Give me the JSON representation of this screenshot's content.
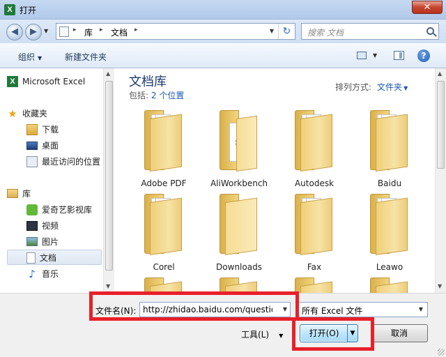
{
  "window": {
    "title": "打开",
    "app_icon": "X",
    "close_glyph": "✕"
  },
  "address_bar": {
    "crumbs": [
      "库",
      "文档"
    ],
    "separators": [
      "▸",
      "▸",
      "▸"
    ],
    "search_placeholder": "搜索 文档"
  },
  "toolbar": {
    "organize": "组织",
    "new_folder": "新建文件夹",
    "help": "?"
  },
  "sidebar": {
    "items": [
      {
        "label": "Microsoft Excel"
      },
      {
        "label": "收藏夹"
      },
      {
        "label": "下载"
      },
      {
        "label": "桌面"
      },
      {
        "label": "最近访问的位置"
      },
      {
        "label": "库"
      },
      {
        "label": "爱奇艺影视库"
      },
      {
        "label": "视频"
      },
      {
        "label": "图片"
      },
      {
        "label": "文档",
        "selected": true
      },
      {
        "label": "音乐"
      }
    ]
  },
  "library": {
    "title": "文档库",
    "includes_label": "包括:",
    "includes_link": "2 个位置",
    "arrange_label": "排列方式:",
    "arrange_value": "文件夹"
  },
  "folders": [
    {
      "name": "Adobe PDF"
    },
    {
      "name": "AliWorkbench"
    },
    {
      "name": "Autodesk"
    },
    {
      "name": "Baidu"
    },
    {
      "name": "Corel"
    },
    {
      "name": "Downloads"
    },
    {
      "name": "Fax"
    },
    {
      "name": "Leawo"
    }
  ],
  "bottom": {
    "filename_label": "文件名(N):",
    "filename_value": "http://zhidao.baidu.com/question",
    "filter_value": "所有 Excel 文件",
    "tools_label": "工具(L)",
    "open_label": "打开(O)",
    "cancel_label": "取消"
  },
  "colors": {
    "highlight": "#e8202a",
    "link": "#1a55b4",
    "title_blue": "#1e3b6d"
  },
  "icons": {
    "back": "arrow-left-icon",
    "forward": "arrow-right-icon",
    "refresh": "refresh-icon",
    "search": "search-icon",
    "help": "help-icon",
    "folder": "folder-icon"
  }
}
